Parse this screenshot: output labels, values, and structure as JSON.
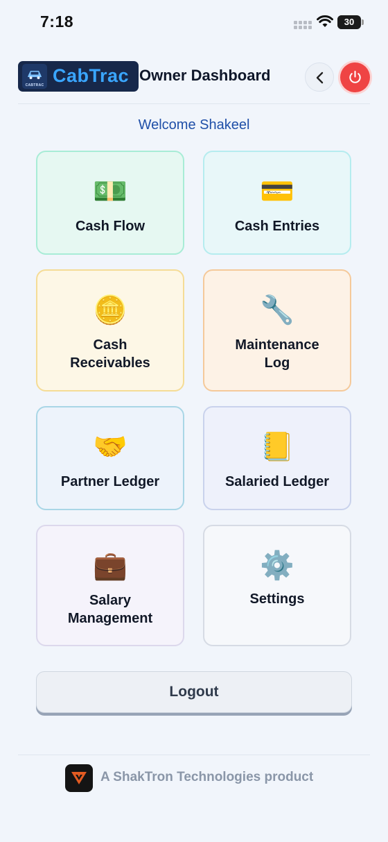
{
  "status_bar": {
    "time": "7:18",
    "battery": "30"
  },
  "header": {
    "logo_text": "CabTrac",
    "logo_mark_text": "CABTRAC",
    "title": "Owner Dashboard"
  },
  "welcome": "Welcome Shakeel",
  "tiles": [
    {
      "emoji": "💵",
      "label": "Cash Flow"
    },
    {
      "emoji": "💳",
      "label": "Cash Entries"
    },
    {
      "emoji": "🪙",
      "label": "Cash\nReceivables"
    },
    {
      "emoji": "🔧",
      "label": "Maintenance\nLog"
    },
    {
      "emoji": "🤝",
      "label": "Partner Ledger"
    },
    {
      "emoji": "📒",
      "label": "Salaried Ledger"
    },
    {
      "emoji": "💼",
      "label": "Salary\nManagement"
    },
    {
      "emoji": "⚙️",
      "label": "Settings"
    }
  ],
  "logout_label": "Logout",
  "footer": {
    "text": "A ShakTron Technologies product"
  },
  "colors": {
    "accent": "#1f4fa8",
    "power": "#ef4444",
    "logo_bg": "#17284a"
  }
}
